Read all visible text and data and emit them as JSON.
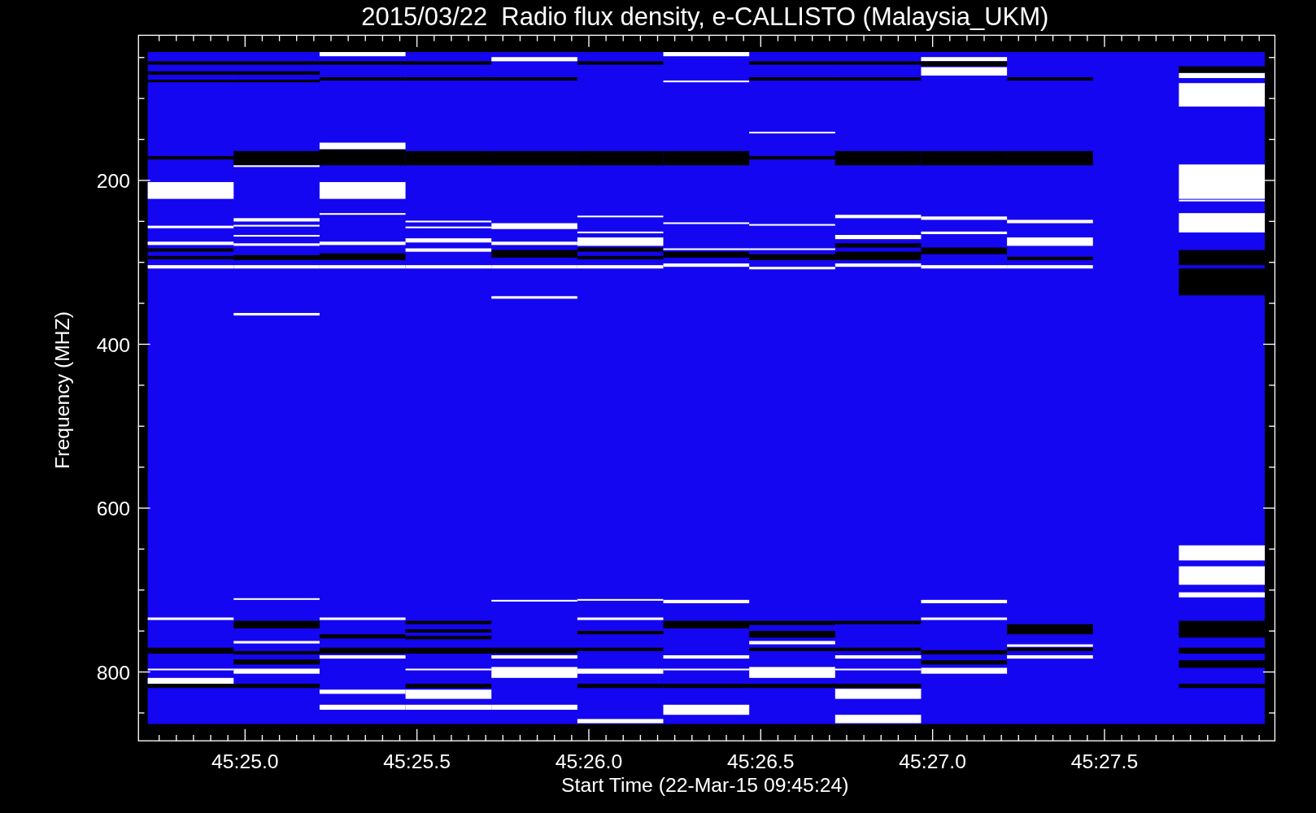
{
  "title": "2015/03/22  Radio flux density, e-CALLISTO (Malaysia_UKM)",
  "y_axis": {
    "label": "Frequency (MHZ)",
    "ticks": [
      "200",
      "400",
      "600",
      "800"
    ]
  },
  "x_axis": {
    "label": "Start Time (22-Mar-15 09:45:24)",
    "ticks": [
      "45:25.0",
      "45:25.5",
      "45:26.0",
      "45:26.5",
      "45:27.0",
      "45:27.5"
    ]
  }
}
